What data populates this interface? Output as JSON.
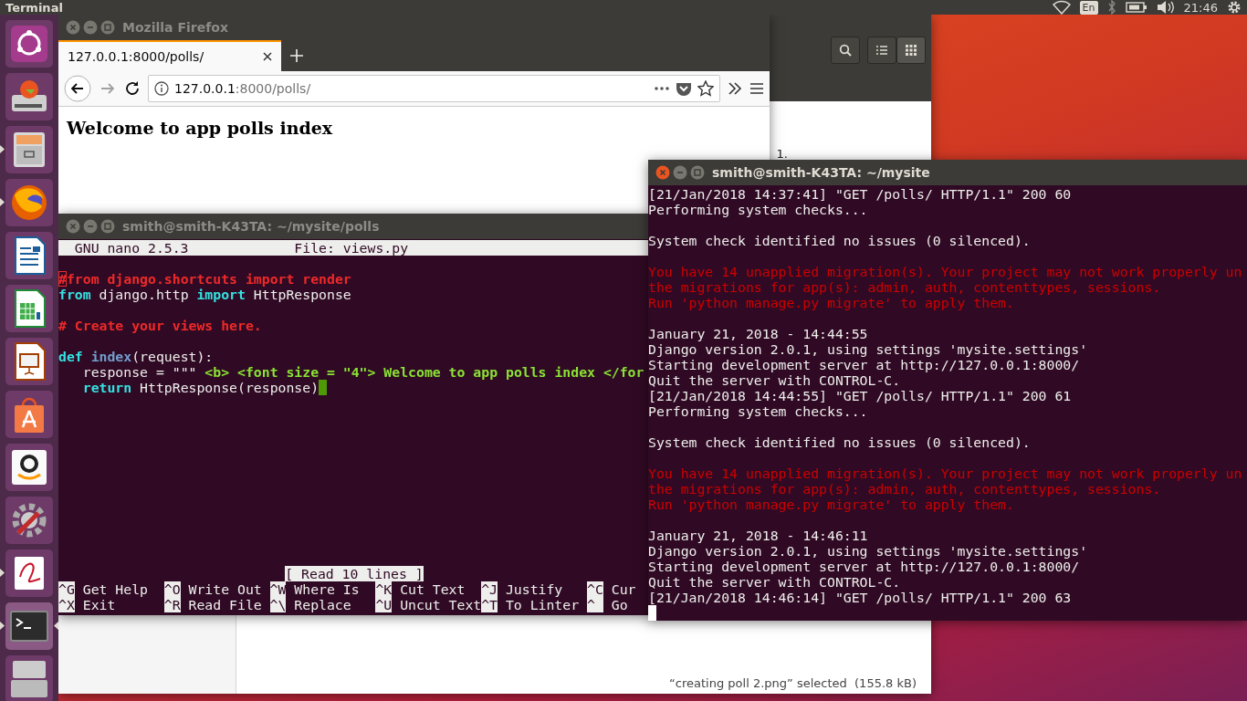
{
  "top_bar": {
    "app_title": "Terminal",
    "keyboard_layout": "En",
    "clock": "21:46"
  },
  "launcher": [
    {
      "kind": "dash",
      "running": false,
      "focused": false
    },
    {
      "kind": "updater",
      "running": false,
      "focused": false
    },
    {
      "kind": "files",
      "running": true,
      "focused": false
    },
    {
      "kind": "browser",
      "running": true,
      "focused": false
    },
    {
      "kind": "writer",
      "running": false,
      "focused": false
    },
    {
      "kind": "calc",
      "running": false,
      "focused": false
    },
    {
      "kind": "impress",
      "running": false,
      "focused": false
    },
    {
      "kind": "store",
      "running": false,
      "focused": false
    },
    {
      "kind": "shop",
      "running": false,
      "focused": false
    },
    {
      "kind": "settings",
      "running": false,
      "focused": false
    },
    {
      "kind": "viewer",
      "running": true,
      "focused": false
    },
    {
      "kind": "terminal",
      "running": true,
      "focused": true
    },
    {
      "kind": "trash",
      "running": false,
      "focused": false
    }
  ],
  "file_manager": {
    "partial_text": "1.",
    "status": "“creating poll 2.png” selected  (155.8 kB)"
  },
  "browser": {
    "title": "Mozilla Firefox",
    "focused": false,
    "tabs": [
      {
        "label": "127.0.0.1:8000/polls/",
        "selected": true
      }
    ],
    "url_host": "127.0.0.1",
    "url_path": ":8000/polls/",
    "heading": "Welcome to app polls index"
  },
  "editor": {
    "title": "smith@smith-K43TA: ~/mysite/polls",
    "focused": false,
    "version": "GNU nano 2.5.3",
    "file": "File: views.py",
    "lines": [
      {
        "kind": "blank"
      },
      {
        "kind": "code",
        "segments": [
          {
            "text": "#",
            "kind": "marker"
          },
          {
            "text": "from django.shortcuts import render",
            "kind": "comment"
          }
        ]
      },
      {
        "kind": "code",
        "segments": [
          {
            "text": "from",
            "kind": "keyword"
          },
          {
            "text": " django.http ",
            "kind": "plain"
          },
          {
            "text": "import",
            "kind": "keyword"
          },
          {
            "text": " HttpResponse",
            "kind": "plain"
          }
        ]
      },
      {
        "kind": "blank"
      },
      {
        "kind": "code",
        "segments": [
          {
            "text": "# Create your views here.",
            "kind": "comment"
          }
        ]
      },
      {
        "kind": "blank"
      },
      {
        "kind": "code",
        "segments": [
          {
            "text": "def",
            "kind": "keyword"
          },
          {
            "text": " index",
            "kind": "function"
          },
          {
            "text": "(request):",
            "kind": "plain"
          }
        ]
      },
      {
        "kind": "code",
        "segments": [
          {
            "text": "   response = \"\"\"",
            "kind": "plain"
          },
          {
            "text": " <b> <font size = \"4\"> Welcome to app polls index </for",
            "kind": "string"
          }
        ]
      },
      {
        "kind": "code",
        "cursor": true,
        "segments": [
          {
            "text": "   return",
            "kind": "keyword"
          },
          {
            "text": " HttpResponse(response)",
            "kind": "plain"
          }
        ]
      }
    ],
    "status": "[ Read 10 lines ]",
    "shortcuts": [
      [
        {
          "key": "^G",
          "label": "Get Help"
        },
        {
          "key": "^O",
          "label": "Write Out"
        },
        {
          "key": "^W",
          "label": "Where Is"
        },
        {
          "key": "^K",
          "label": "Cut Text"
        },
        {
          "key": "^J",
          "label": "Justify"
        },
        {
          "key": "^C",
          "label": "Cur"
        }
      ],
      [
        {
          "key": "^X",
          "label": "Exit"
        },
        {
          "key": "^R",
          "label": "Read File"
        },
        {
          "key": "^\\",
          "label": "Replace"
        },
        {
          "key": "^U",
          "label": "Uncut Text"
        },
        {
          "key": "^T",
          "label": "To Linter"
        },
        {
          "key": "^_",
          "label": "Go"
        }
      ]
    ]
  },
  "server_terminal": {
    "title": "smith@smith-K43TA: ~/mysite",
    "focused": true,
    "lines": [
      {
        "kind": "normal",
        "text": "[21/Jan/2018 14:37:41] \"GET /polls/ HTTP/1.1\" 200 60"
      },
      {
        "kind": "normal",
        "text": "Performing system checks..."
      },
      {
        "kind": "blank"
      },
      {
        "kind": "normal",
        "text": "System check identified no issues (0 silenced)."
      },
      {
        "kind": "blank"
      },
      {
        "kind": "error",
        "text": "You have 14 unapplied migration(s). Your project may not work properly un"
      },
      {
        "kind": "error",
        "text": "the migrations for app(s): admin, auth, contenttypes, sessions."
      },
      {
        "kind": "error",
        "text": "Run 'python manage.py migrate' to apply them."
      },
      {
        "kind": "blank"
      },
      {
        "kind": "normal",
        "text": "January 21, 2018 - 14:44:55"
      },
      {
        "kind": "normal",
        "text": "Django version 2.0.1, using settings 'mysite.settings'"
      },
      {
        "kind": "normal",
        "text": "Starting development server at http://127.0.0.1:8000/"
      },
      {
        "kind": "normal",
        "text": "Quit the server with CONTROL-C."
      },
      {
        "kind": "normal",
        "text": "[21/Jan/2018 14:44:55] \"GET /polls/ HTTP/1.1\" 200 61"
      },
      {
        "kind": "normal",
        "text": "Performing system checks..."
      },
      {
        "kind": "blank"
      },
      {
        "kind": "normal",
        "text": "System check identified no issues (0 silenced)."
      },
      {
        "kind": "blank"
      },
      {
        "kind": "error",
        "text": "You have 14 unapplied migration(s). Your project may not work properly un"
      },
      {
        "kind": "error",
        "text": "the migrations for app(s): admin, auth, contenttypes, sessions."
      },
      {
        "kind": "error",
        "text": "Run 'python manage.py migrate' to apply them."
      },
      {
        "kind": "blank"
      },
      {
        "kind": "normal",
        "text": "January 21, 2018 - 14:46:11"
      },
      {
        "kind": "normal",
        "text": "Django version 2.0.1, using settings 'mysite.settings'"
      },
      {
        "kind": "normal",
        "text": "Starting development server at http://127.0.0.1:8000/"
      },
      {
        "kind": "normal",
        "text": "Quit the server with CONTROL-C."
      },
      {
        "kind": "normal",
        "text": "[21/Jan/2018 14:46:14] \"GET /polls/ HTTP/1.1\" 200 63"
      },
      {
        "kind": "cursor"
      }
    ]
  }
}
